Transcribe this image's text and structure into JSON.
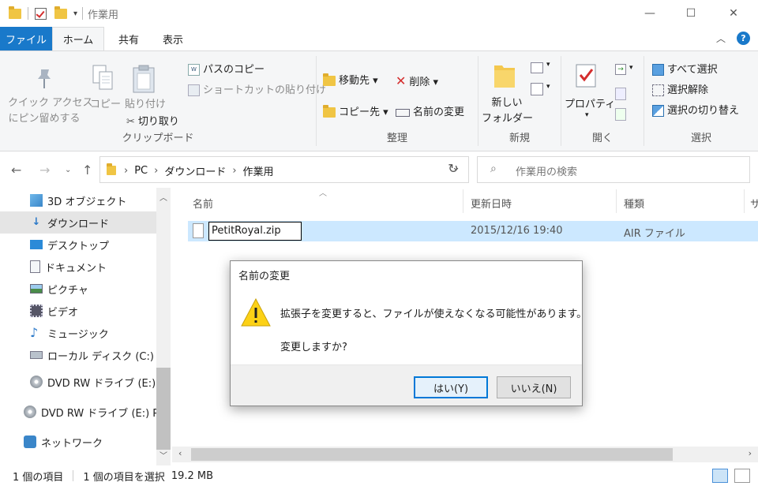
{
  "window": {
    "title": "作業用",
    "minimize": "—",
    "maximize": "☐",
    "close": "✕"
  },
  "ribbon_tabs": {
    "file": "ファイル",
    "home": "ホーム",
    "share": "共有",
    "view": "表示"
  },
  "ribbon": {
    "clipboard": {
      "label": "クリップボード",
      "pin_quick_line1": "クイック アクセス",
      "pin_quick_line2": "にピン留めする",
      "copy": "コピー",
      "paste": "貼り付け",
      "copy_path": "パスのコピー",
      "paste_shortcut": "ショートカットの貼り付け",
      "cut": "切り取り"
    },
    "organize": {
      "label": "整理",
      "move_to": "移動先 ▾",
      "copy_to": "コピー先 ▾",
      "delete": "削除 ▾",
      "rename": "名前の変更"
    },
    "new": {
      "label": "新規",
      "new_folder_line1": "新しい",
      "new_folder_line2": "フォルダー"
    },
    "open": {
      "label": "開く",
      "properties": "プロパティ"
    },
    "select": {
      "label": "選択",
      "select_all": "すべて選択",
      "select_none": "選択解除",
      "invert": "選択の切り替え"
    }
  },
  "address": {
    "crumbs": [
      "PC",
      "ダウンロード",
      "作業用"
    ],
    "separator": "›",
    "search_placeholder": "作業用の検索"
  },
  "nav": {
    "items": [
      {
        "label": "3D オブジェクト"
      },
      {
        "label": "ダウンロード"
      },
      {
        "label": "デスクトップ"
      },
      {
        "label": "ドキュメント"
      },
      {
        "label": "ピクチャ"
      },
      {
        "label": "ビデオ"
      },
      {
        "label": "ミュージック"
      },
      {
        "label": "ローカル ディスク (C:)"
      },
      {
        "label": "DVD RW ドライブ (E:) P"
      },
      {
        "label": "DVD RW ドライブ (E:) Pe"
      },
      {
        "label": "ネットワーク"
      }
    ]
  },
  "columns": {
    "name": "名前",
    "modified": "更新日時",
    "type": "種類",
    "size": "サ"
  },
  "file": {
    "name": "PetitRoyal.zip",
    "modified": "2015/12/16 19:40",
    "type": "AIR ファイル"
  },
  "dialog": {
    "title": "名前の変更",
    "message": "拡張子を変更すると、ファイルが使えなくなる可能性があります。",
    "question": "変更しますか?",
    "yes": "はい(Y)",
    "no": "いいえ(N)"
  },
  "status": {
    "count": "1 個の項目",
    "selected": "1 個の項目を選択",
    "size": "19.2 MB"
  }
}
